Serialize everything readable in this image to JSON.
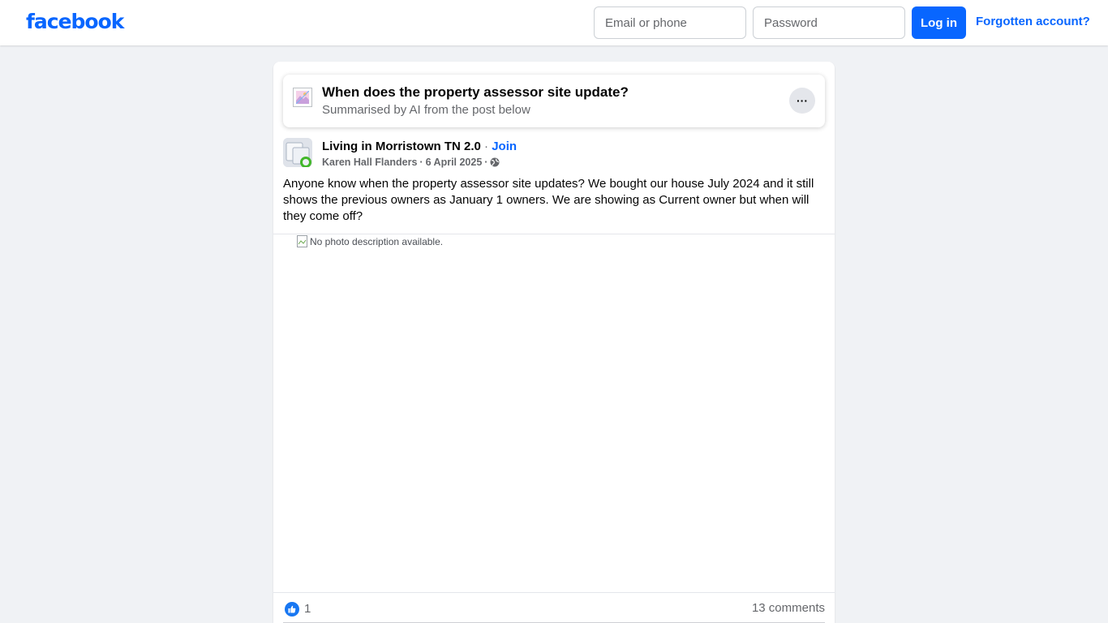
{
  "header": {
    "logo": "facebook",
    "email_placeholder": "Email or phone",
    "password_placeholder": "Password",
    "login_label": "Log in",
    "forgot_label": "Forgotten account?"
  },
  "ai_summary": {
    "title": "When does the property assessor site update?",
    "subtitle": "Summarised by AI from the post below",
    "more_label": "···"
  },
  "post": {
    "group_name": "Living in Morristown TN 2.0",
    "separator": " · ",
    "join_label": "Join",
    "author": "Karen Hall Flanders",
    "date": "6 April 2025",
    "privacy_icon": "globe-icon",
    "text": "Anyone know when the property assessor site updates? We bought our house July 2024 and it still shows the previous owners as January 1 owners. We are showing as Current owner but when will they come off?",
    "image_alt": "No photo description available."
  },
  "reactions": {
    "like_count": "1",
    "comments": "13 comments"
  },
  "colors": {
    "brand": "#0866ff",
    "background": "#f0f2f5",
    "secondary_text": "#65676b"
  }
}
